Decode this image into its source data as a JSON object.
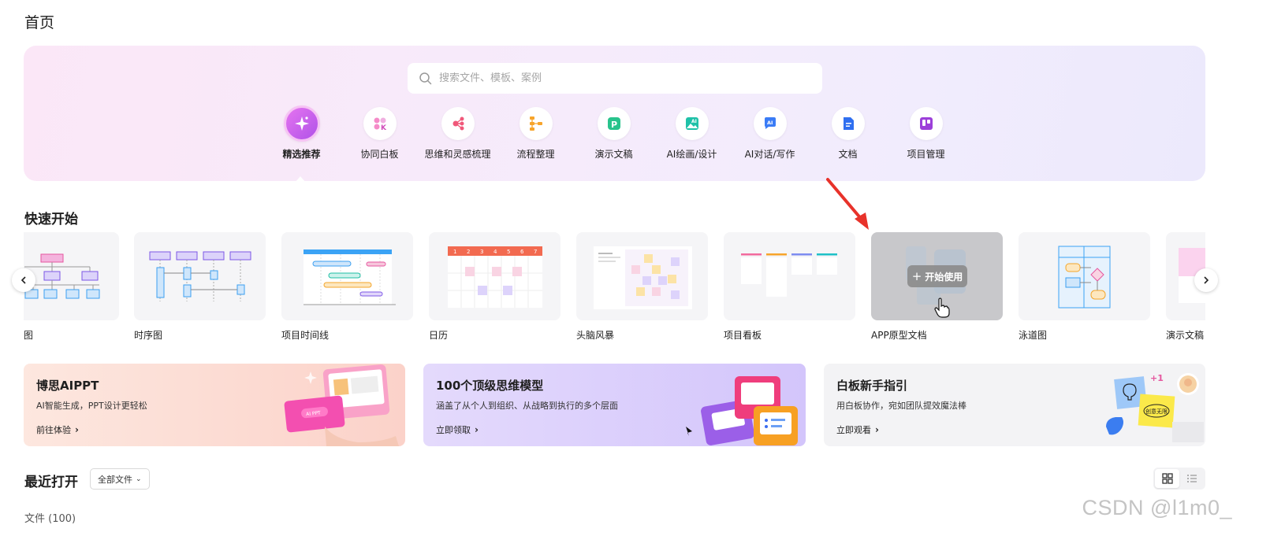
{
  "page": {
    "title": "首页"
  },
  "search": {
    "placeholder": "搜索文件、模板、案例",
    "icon": "search-icon"
  },
  "categories": [
    {
      "label": "精选推荐",
      "icon": "sparkle-icon",
      "active": true
    },
    {
      "label": "协同白板",
      "icon": "whiteboard-icon"
    },
    {
      "label": "思维和灵感梳理",
      "icon": "mindmap-icon"
    },
    {
      "label": "流程整理",
      "icon": "flowchart-icon"
    },
    {
      "label": "演示文稿",
      "icon": "presentation-icon"
    },
    {
      "label": "AI绘画/设计",
      "icon": "ai-image-icon"
    },
    {
      "label": "AI对话/写作",
      "icon": "ai-chat-icon"
    },
    {
      "label": "文档",
      "icon": "document-icon"
    },
    {
      "label": "项目管理",
      "icon": "project-board-icon"
    }
  ],
  "quick_start": {
    "title": "快速开始",
    "start_label": "开始使用",
    "templates": [
      {
        "name": "图",
        "thumb": "org-chart"
      },
      {
        "name": "时序图",
        "thumb": "sequence"
      },
      {
        "name": "项目时间线",
        "thumb": "timeline"
      },
      {
        "name": "日历",
        "thumb": "calendar"
      },
      {
        "name": "头脑风暴",
        "thumb": "brainstorm"
      },
      {
        "name": "项目看板",
        "thumb": "kanban"
      },
      {
        "name": "APP原型文档",
        "thumb": "prototype",
        "hovered": true
      },
      {
        "name": "泳道图",
        "thumb": "swimlane"
      },
      {
        "name": "演示文稿",
        "thumb": "presentation"
      }
    ],
    "calendar_days": [
      "1",
      "2",
      "3",
      "4",
      "5",
      "6",
      "7"
    ]
  },
  "banners": [
    {
      "title": "博思AIPPT",
      "subtitle": "AI智能生成，PPT设计更轻松",
      "link": "前往体验",
      "bg": "#fde3dc",
      "art_text": "AI PPT"
    },
    {
      "title": "100个顶级思维模型",
      "subtitle": "涵盖了从个人到组织、从战略到执行的多个层面",
      "link": "立即领取",
      "bg": "#ddd2fb"
    },
    {
      "title": "白板新手指引",
      "subtitle": "用白板协作，宛如团队提效魔法棒",
      "link": "立即观看",
      "bg": "#f3f3f5",
      "art_text": "创意无限",
      "badge": "+1"
    }
  ],
  "recent": {
    "title": "最近打开",
    "filter_label": "全部文件",
    "file_count_label": "文件 (100)",
    "views": [
      "grid-view-icon",
      "list-view-icon"
    ]
  },
  "watermark": "CSDN @l1m0_",
  "colors": {
    "accent_purple": "#b052e8",
    "pink": "#e574f0",
    "red_arrow": "#e8322a"
  }
}
